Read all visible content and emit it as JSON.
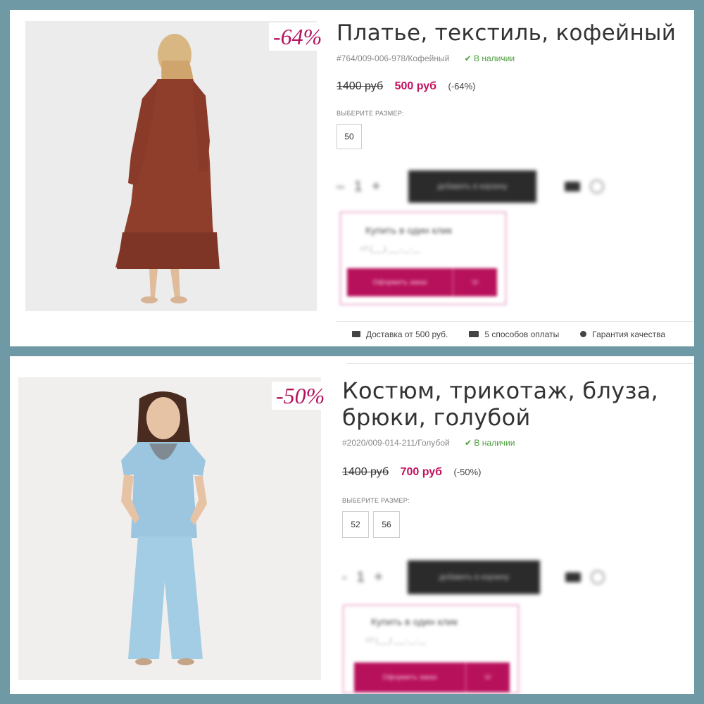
{
  "products": [
    {
      "discount_badge": "-64%",
      "title": "Платье, текстиль, кофейный",
      "sku": "#764/009-006-978/Кофейный",
      "stock": "✔ В наличии",
      "old_price": "1400 руб",
      "new_price": "500 руб",
      "discount": "(-64%)",
      "size_label": "ВЫБЕРИТЕ РАЗМЕР:",
      "sizes": [
        "50"
      ],
      "cart_button": "добавить в корзину",
      "qty": "1",
      "one_click_title": "Купить в один клик",
      "one_click_sub": "+7 (___) ___-__-__",
      "one_click_button": "Оформить заказ"
    },
    {
      "discount_badge": "-50%",
      "title": "Костюм, трикотаж, блуза, брюки, голубой",
      "sku": "#2020/009-014-211/Голубой",
      "stock": "✔ В наличии",
      "old_price": "1400 руб",
      "new_price": "700 руб",
      "discount": "(-50%)",
      "size_label": "ВЫБЕРИТЕ РАЗМЕР:",
      "sizes": [
        "52",
        "56"
      ],
      "cart_button": "добавить в корзину",
      "qty": "1",
      "one_click_title": "Купить в один клик",
      "one_click_sub": "+7 (___) ___-__-__",
      "one_click_button": "Оформить заказ"
    }
  ],
  "footer": {
    "delivery": "Доставка от 500 руб.",
    "payment": "5 способов оплаты",
    "quality": "Гарантия качества"
  },
  "colors": {
    "frame": "#6f9aa5",
    "accent": "#c2125f",
    "stock": "#4a9d3a"
  }
}
